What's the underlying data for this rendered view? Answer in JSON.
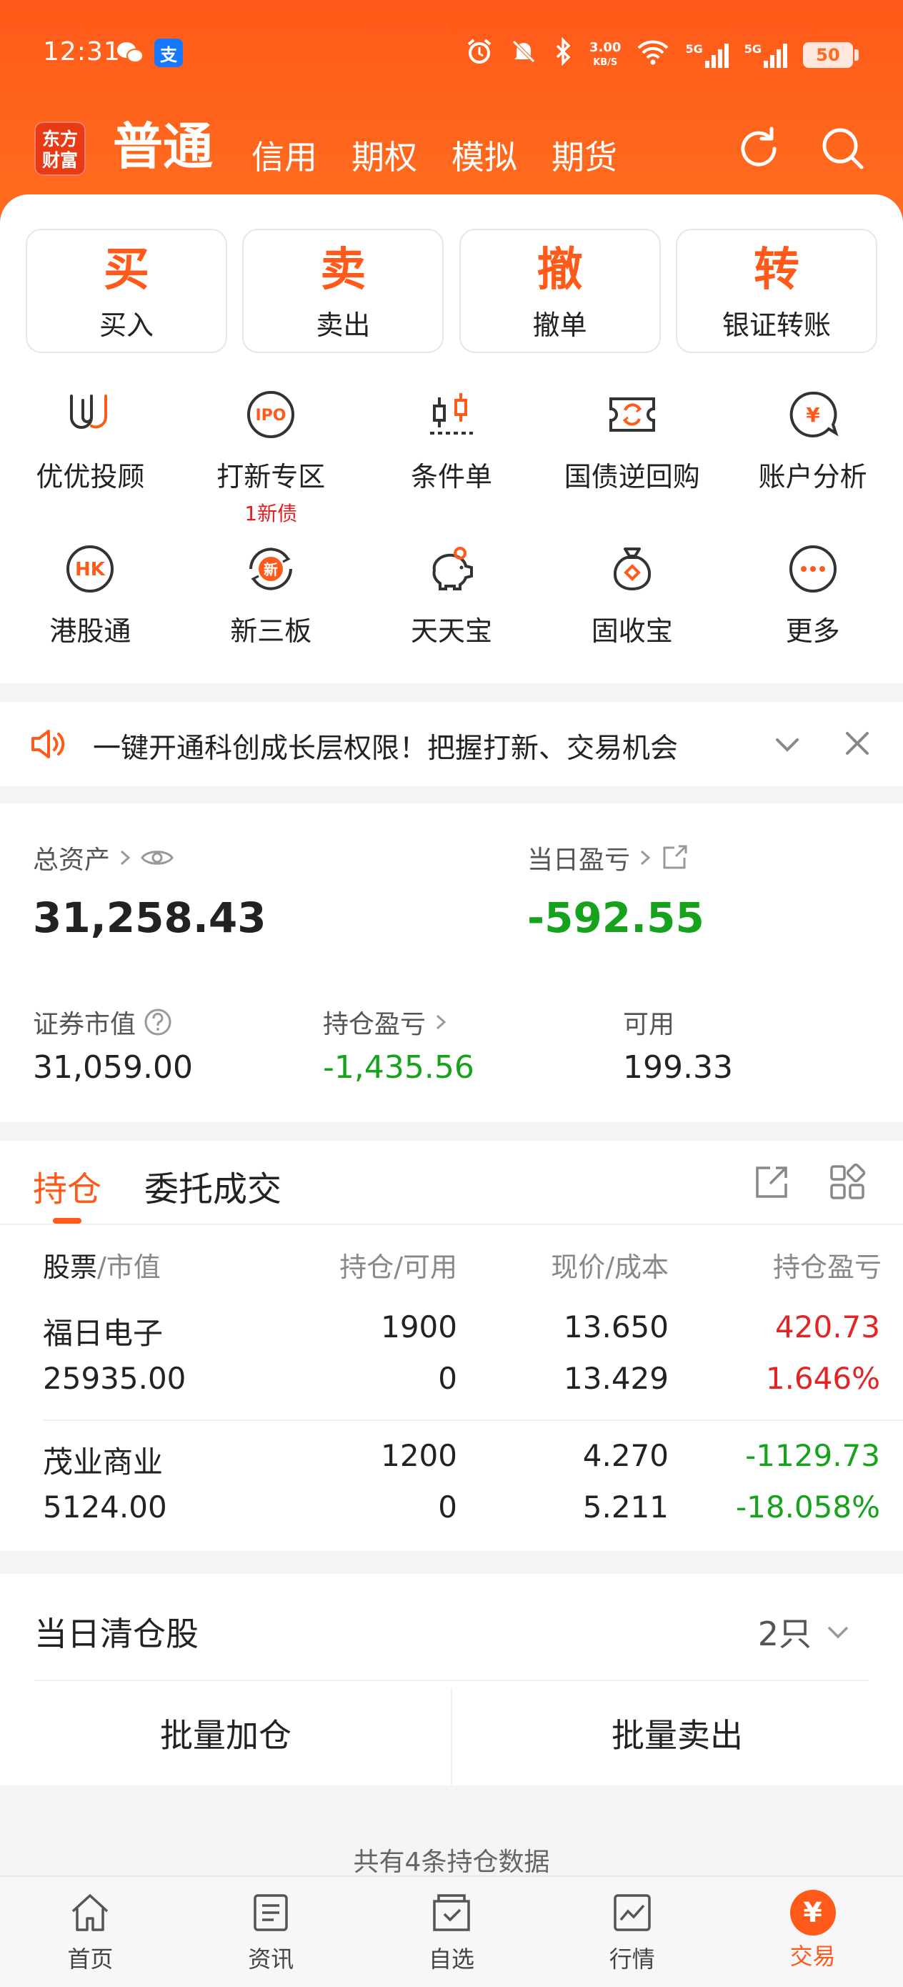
{
  "status_bar": {
    "time": "12:31",
    "net_speed_value": "3.00",
    "net_speed_unit": "KB/S",
    "signal_1": "5G",
    "signal_2": "5G",
    "battery": "50"
  },
  "nav": {
    "logo_line1": "东方",
    "logo_line2": "财富",
    "tabs": [
      "普通",
      "信用",
      "期权",
      "模拟",
      "期货"
    ],
    "active_tab": 0
  },
  "trade_buttons": [
    {
      "big": "买",
      "label": "买入"
    },
    {
      "big": "卖",
      "label": "卖出"
    },
    {
      "big": "撤",
      "label": "撤单"
    },
    {
      "big": "转",
      "label": "银证转账"
    }
  ],
  "grid": {
    "row1": [
      {
        "label": "优优投顾",
        "icon": "uu-icon"
      },
      {
        "label": "打新专区",
        "icon": "ipo-icon",
        "sub": "1新债"
      },
      {
        "label": "条件单",
        "icon": "candlestick-icon"
      },
      {
        "label": "国债逆回购",
        "icon": "bond-repo-icon"
      },
      {
        "label": "账户分析",
        "icon": "yen-chat-icon"
      }
    ],
    "row2": [
      {
        "label": "港股通",
        "icon": "hk-icon"
      },
      {
        "label": "新三板",
        "icon": "new-board-icon"
      },
      {
        "label": "天天宝",
        "icon": "piggy-bank-icon"
      },
      {
        "label": "固收宝",
        "icon": "money-bag-icon"
      },
      {
        "label": "更多",
        "icon": "more-icon"
      }
    ]
  },
  "notice": {
    "text": "一键开通科创成长层权限！把握打新、交易机会"
  },
  "assets": {
    "total_label": "总资产",
    "total_value": "31,258.43",
    "daily_pl_label": "当日盈亏",
    "daily_pl_value": "-592.55",
    "market_value_label": "证券市值",
    "market_value": "31,059.00",
    "position_pl_label": "持仓盈亏",
    "position_pl": "-1,435.56",
    "available_label": "可用",
    "available": "199.33"
  },
  "holdings": {
    "tabs": [
      "持仓",
      "委托成交"
    ],
    "headers": {
      "h1a": "股票",
      "h1b": "/市值",
      "h2": "持仓/可用",
      "h3": "现价/成本",
      "h4": "持仓盈亏"
    },
    "rows": [
      {
        "name": "福日电子",
        "market_value": "25935.00",
        "position": "1900",
        "available": "0",
        "price": "13.650",
        "cost": "13.429",
        "pl": "420.73",
        "pl_pct": "1.646%",
        "color": "#e32424"
      },
      {
        "name": "茂业商业",
        "market_value": "5124.00",
        "position": "1200",
        "available": "0",
        "price": "4.270",
        "cost": "5.211",
        "pl": "-1129.73",
        "pl_pct": "-18.058%",
        "color": "#16a21a"
      }
    ]
  },
  "clearance": {
    "title": "当日清仓股",
    "count": "2只",
    "batch_add": "批量加仓",
    "batch_sell": "批量卖出"
  },
  "footer_note": "共有4条持仓数据",
  "tabbar": {
    "items": [
      "首页",
      "资讯",
      "自选",
      "行情",
      "交易"
    ],
    "active_symbol": "¥"
  },
  "colors": {
    "brand": "#ff5a1a",
    "up": "#e32424",
    "down": "#16a21a"
  }
}
